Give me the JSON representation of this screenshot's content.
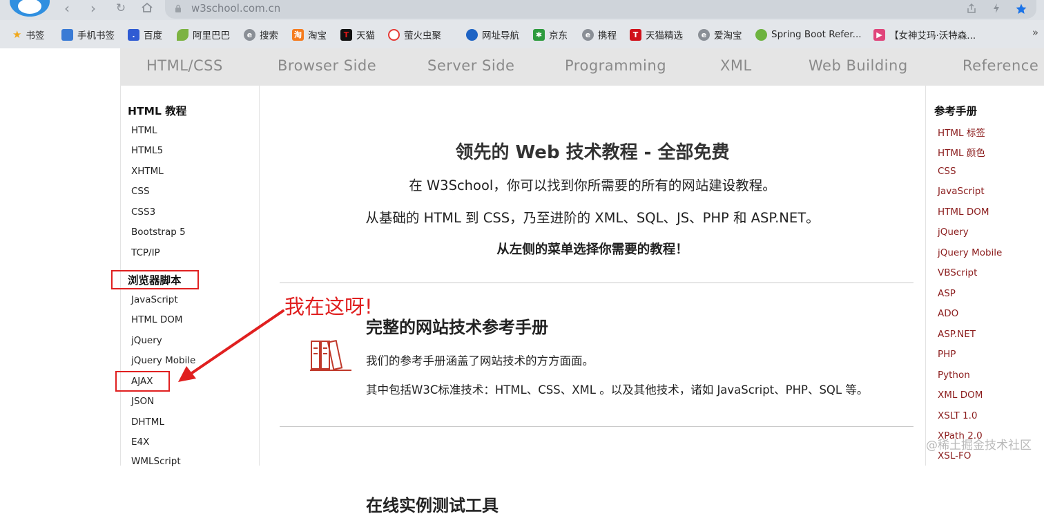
{
  "browser": {
    "url": "w3school.com.cn",
    "bookmarks": [
      {
        "label": "书签",
        "icon": "star-icon",
        "color": "#f0a81b"
      },
      {
        "label": "手机书签",
        "icon": "phone-icon",
        "color": "#3a7bd5"
      },
      {
        "label": "百度",
        "icon": "baidu-icon",
        "color": "#2f5bd3"
      },
      {
        "label": "阿里巴巴",
        "icon": "leaf-icon",
        "color": "#7cb342"
      },
      {
        "label": "搜索",
        "icon": "browser-e-icon",
        "color": "#8a8f96"
      },
      {
        "label": "淘宝",
        "icon": "taobao-icon",
        "color": "#f57c1f"
      },
      {
        "label": "天猫",
        "icon": "tmall-icon",
        "color": "#111111"
      },
      {
        "label": "萤火虫聚",
        "icon": "firefly-icon",
        "color": "#e53935"
      },
      {
        "label": "网址导航",
        "icon": "compass-icon",
        "color": "#1e63c4"
      },
      {
        "label": "京东",
        "icon": "jd-icon",
        "color": "#2e9b3e"
      },
      {
        "label": "携程",
        "icon": "browser-e-icon",
        "color": "#8a8f96"
      },
      {
        "label": "天猫精选",
        "icon": "tmall-t-icon",
        "color": "#d0111a"
      },
      {
        "label": "爱淘宝",
        "icon": "browser-e-icon",
        "color": "#8a8f96"
      },
      {
        "label": "Spring Boot Refer...",
        "icon": "spring-leaf-icon",
        "color": "#6db33f"
      },
      {
        "label": "【女神艾玛·沃特森...",
        "icon": "play-icon",
        "color": "#e0457b"
      }
    ],
    "more_symbol": "»"
  },
  "topnav": [
    "HTML/CSS",
    "Browser Side",
    "Server Side",
    "Programming",
    "XML",
    "Web Building",
    "Reference"
  ],
  "sidebar": {
    "heading1": "HTML 教程",
    "group1": [
      "HTML",
      "HTML5",
      "XHTML",
      "CSS",
      "CSS3",
      "Bootstrap 5",
      "TCP/IP"
    ],
    "heading2": "浏览器脚本",
    "group2": [
      "JavaScript",
      "HTML DOM",
      "jQuery",
      "jQuery Mobile",
      "AJAX",
      "JSON",
      "DHTML",
      "E4X",
      "WMLScript"
    ]
  },
  "main": {
    "hero_title": "领先的 Web 技术教程 - 全部免费",
    "hero_line1": "在 W3School，你可以找到你所需要的所有的网站建设教程。",
    "hero_line2": "从基础的 HTML 到 CSS，乃至进阶的 XML、SQL、JS、PHP 和 ASP.NET。",
    "hero_cta": "从左侧的菜单选择你需要的教程！",
    "ref_title": "完整的网站技术参考手册",
    "ref_desc1": "我们的参考手册涵盖了网站技术的方方面面。",
    "ref_desc2": "其中包括W3C标准技术：HTML、CSS、XML 。以及其他技术，诸如 JavaScript、PHP、SQL 等。",
    "tools_title": "在线实例测试工具"
  },
  "reference": {
    "heading": "参考手册",
    "links": [
      "HTML 标签",
      "HTML 颜色",
      "CSS",
      "JavaScript",
      "HTML DOM",
      "jQuery",
      "jQuery Mobile",
      "VBScript",
      "ASP",
      "ADO",
      "ASP.NET",
      "PHP",
      "Python",
      "XML DOM",
      "XSLT 1.0",
      "XPath 2.0",
      "XSL-FO"
    ]
  },
  "annotation": {
    "text": "我在这呀!",
    "color": "#e02020"
  },
  "watermark": "@稀土掘金技术社区"
}
